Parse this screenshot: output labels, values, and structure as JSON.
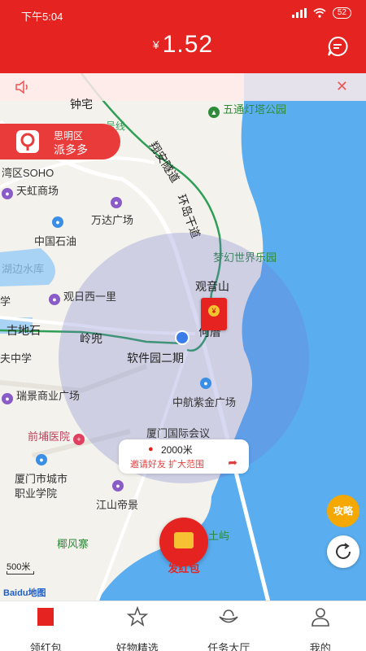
{
  "status": {
    "time": "下午5:04",
    "battery": "52"
  },
  "header": {
    "currency_symbol": "¥",
    "balance": "1.52"
  },
  "area_card": {
    "district": "思明区",
    "name": "派多多"
  },
  "map_labels": {
    "zhongzhai": "钟宅",
    "line": "号线",
    "xiang_an_tunnel": "翔安隧道",
    "huandao_road": "环岛干道",
    "wutong_park": "五通灯塔公园",
    "wanqu": "湾区SOHO",
    "tianhong": "天虹商场",
    "wanda": "万达广场",
    "cnpc": "中国石油",
    "dream_park": "梦幻世界乐园",
    "hubian": "湖边水库",
    "xue": "学",
    "guanri": "观日西一里",
    "guanyinshan": "观音山",
    "gudishi": "古地石",
    "lingdou": "岭兜",
    "hecuo": "何厝",
    "fu_middle": "夫中学",
    "software_park": "软件园二期",
    "ruijing": "瑞景商业广场",
    "avic": "中航紫金广场",
    "qianpu_hospital": "前埔医院",
    "convention": "厦门国际会议",
    "vocational_1": "厦门市城市",
    "vocational_2": "职业学院",
    "jiangshan": "江山帝景",
    "yefengzhai": "椰风寨",
    "tuyu": "土屿"
  },
  "range": {
    "distance": "2000米",
    "invite": "邀请好友 扩大范围"
  },
  "buttons": {
    "strategy": "攻略",
    "send_packet": "发红包"
  },
  "map_meta": {
    "scale": "500米",
    "brand": "Baidu地图"
  },
  "tabs": [
    {
      "label": "领红包",
      "icon": "red-packet-icon"
    },
    {
      "label": "好物精选",
      "icon": "star-icon"
    },
    {
      "label": "任务大厅",
      "icon": "ingot-icon"
    },
    {
      "label": "我的",
      "icon": "user-icon"
    }
  ],
  "colors": {
    "brand_red": "#e52421",
    "sea": "#5aaef0",
    "strategy": "#f5a800"
  }
}
